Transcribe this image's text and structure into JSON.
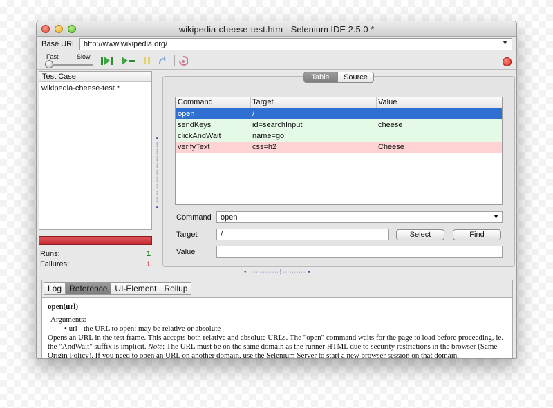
{
  "window": {
    "title": "wikipedia-cheese-test.htm - Selenium IDE 2.5.0 *"
  },
  "base_url": {
    "label": "Base URL",
    "value": "http://www.wikipedia.org/"
  },
  "toolbar": {
    "speed_fast": "Fast",
    "speed_slow": "Slow",
    "icons": [
      "play-all-icon",
      "play-current-icon",
      "pause-icon",
      "step-icon",
      "rollup-icon",
      "record-icon"
    ]
  },
  "test_case_panel": {
    "header": "Test Case",
    "items": [
      "wikipedia-cheese-test *"
    ]
  },
  "stats": {
    "runs_label": "Runs:",
    "runs_value": "1",
    "failures_label": "Failures:",
    "failures_value": "1"
  },
  "view_toggle": {
    "table": "Table",
    "source": "Source",
    "selected": "Table"
  },
  "command_table": {
    "headers": [
      "Command",
      "Target",
      "Value"
    ],
    "rows": [
      {
        "command": "open",
        "target": "/",
        "value": "",
        "state": "selected"
      },
      {
        "command": "sendKeys",
        "target": "id=searchInput",
        "value": "cheese",
        "state": "passed"
      },
      {
        "command": "clickAndWait",
        "target": "name=go",
        "value": "",
        "state": "passed"
      },
      {
        "command": "verifyText",
        "target": "css=h2",
        "value": "Cheese",
        "state": "failed"
      }
    ]
  },
  "editor": {
    "command_label": "Command",
    "command_value": "open",
    "target_label": "Target",
    "target_value": "/",
    "select_button": "Select",
    "find_button": "Find",
    "value_label": "Value",
    "value_value": ""
  },
  "bottom_tabs": {
    "tabs": [
      "Log",
      "Reference",
      "UI-Element",
      "Rollup"
    ],
    "active": "Reference"
  },
  "reference": {
    "title": "open(url)",
    "args_label": "Arguments:",
    "arg_bullet": "url - the URL to open; may be relative or absolute",
    "desc_line1": "Opens an URL in the test frame. This accepts both relative and absolute URLs. The \"open\" command waits for the page to load before proceeding, ie.",
    "desc_line2a": "the \"AndWait\" suffix is implicit.",
    "desc_note": "Note",
    "desc_line2b": ": The URL must be on the same domain as the runner HTML due to security restrictions in the browser (Same",
    "desc_line3": "Origin Policy). If you need to open an URL on another domain, use the Selenium Server to start a new browser session on that domain."
  },
  "colors": {
    "selected_row": "#2f6fd1",
    "passed_row": "#e4f9e6",
    "failed_row": "#ffd3d3",
    "progress_fail": "#c22a32",
    "runs_value_color": "#1f8a1f",
    "failures_value_color": "#cc1111"
  }
}
